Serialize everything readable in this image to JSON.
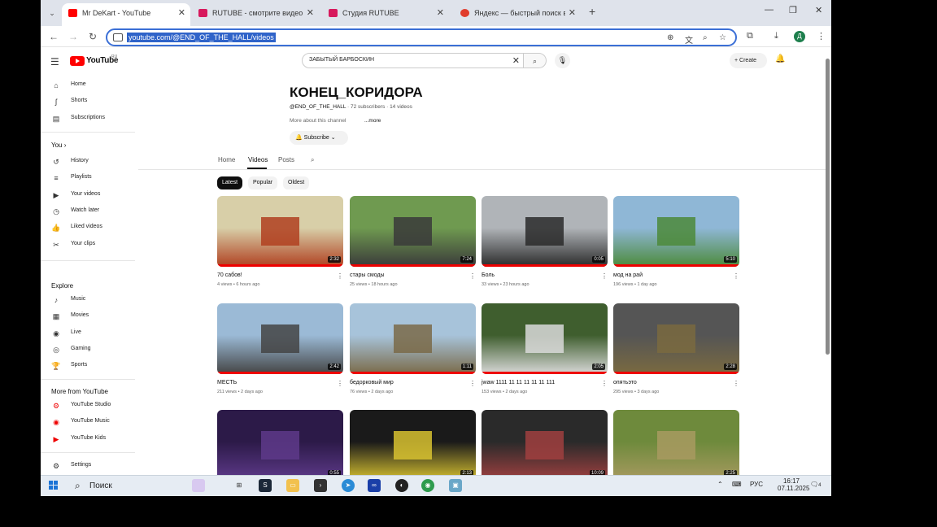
{
  "browser": {
    "tabs": [
      {
        "title": "Mr DeKart - YouTube",
        "favicon_color": "#ff0000"
      },
      {
        "title": "RUTUBE - смотрите видео онл...",
        "favicon_color": "#d7195d"
      },
      {
        "title": "Студия RUTUBE",
        "favicon_color": "#d7195d"
      },
      {
        "title": "Яндекс — быстрый поиск в ин...",
        "favicon_color": "#e03c2c"
      }
    ],
    "url": "youtube.com/@END_OF_THE_HALL/videos",
    "profile_initial": "Д"
  },
  "youtube": {
    "logo_text": "YouTube",
    "logo_region": "RU",
    "search_value": "ЗАБЫТЫЙ БАРБОСКИН",
    "create_label": "Create"
  },
  "sidebar": {
    "main": [
      {
        "label": "Home",
        "icon": "home-icon",
        "glyph": "⌂"
      },
      {
        "label": "Shorts",
        "icon": "shorts-icon",
        "glyph": "ʃ"
      },
      {
        "label": "Subscriptions",
        "icon": "subscriptions-icon",
        "glyph": "▤"
      }
    ],
    "you_title": "You",
    "you": [
      {
        "label": "History",
        "icon": "history-icon",
        "glyph": "↺"
      },
      {
        "label": "Playlists",
        "icon": "playlists-icon",
        "glyph": "≡"
      },
      {
        "label": "Your videos",
        "icon": "your-videos-icon",
        "glyph": "▶"
      },
      {
        "label": "Watch later",
        "icon": "watch-later-icon",
        "glyph": "◷"
      },
      {
        "label": "Liked videos",
        "icon": "liked-icon",
        "glyph": "👍"
      },
      {
        "label": "Your clips",
        "icon": "clips-icon",
        "glyph": "✂"
      }
    ],
    "explore_title": "Explore",
    "explore": [
      {
        "label": "Music",
        "icon": "music-icon",
        "glyph": "♪"
      },
      {
        "label": "Movies",
        "icon": "movies-icon",
        "glyph": "▦"
      },
      {
        "label": "Live",
        "icon": "live-icon",
        "glyph": "◉"
      },
      {
        "label": "Gaming",
        "icon": "gaming-icon",
        "glyph": "◎"
      },
      {
        "label": "Sports",
        "icon": "sports-icon",
        "glyph": "🏆"
      }
    ],
    "more_title": "More from YouTube",
    "more": [
      {
        "label": "YouTube Studio",
        "icon": "youtube-studio-icon",
        "glyph": "⚙"
      },
      {
        "label": "YouTube Music",
        "icon": "youtube-music-icon",
        "glyph": "◉"
      },
      {
        "label": "YouTube Kids",
        "icon": "youtube-kids-icon",
        "glyph": "▶"
      }
    ],
    "settings": {
      "label": "Settings",
      "icon": "settings-icon",
      "glyph": "⚙"
    }
  },
  "channel": {
    "name": "КОНЕЦ_КОРИДОРА",
    "handle": "@END_OF_THE_HALL",
    "subscribers": "72 subscribers",
    "videos_count": "14 videos",
    "about": "More about this channel",
    "more": "...more",
    "subscribe_label": "Subscribe",
    "tabs": [
      "Home",
      "Videos",
      "Posts"
    ],
    "active_tab": "Videos",
    "chips": [
      "Latest",
      "Popular",
      "Oldest"
    ],
    "active_chip": "Latest"
  },
  "videos": [
    {
      "title": "70 сабов!",
      "views": "4 views",
      "age": "6 hours ago",
      "duration": "2:32",
      "bg": "#d8cfa8",
      "accent": "#b04020"
    },
    {
      "title": "стары смоды",
      "views": "25 views",
      "age": "18 hours ago",
      "duration": "7:24",
      "bg": "#6f9a50",
      "accent": "#3a3a3a"
    },
    {
      "title": "Боль",
      "views": "33 views",
      "age": "23 hours ago",
      "duration": "0:05",
      "bg": "#b0b4b8",
      "accent": "#2a2a2a"
    },
    {
      "title": "мод на рай",
      "views": "196 views",
      "age": "1 day ago",
      "duration": "5:10",
      "bg": "#8fb7d6",
      "accent": "#4c8a3a"
    },
    {
      "title": "МЕСТЬ",
      "views": "211 views",
      "age": "2 days ago",
      "duration": "2:42",
      "bg": "#9bbad6",
      "accent": "#444444"
    },
    {
      "title": "бедорковый мир",
      "views": "76 views",
      "age": "2 days ago",
      "duration": "1:11",
      "bg": "#a7c3da",
      "accent": "#7a6a48"
    },
    {
      "title": "jwaw 1111 11 11 11 11 11 111",
      "views": "153 views",
      "age": "2 days ago",
      "duration": "2:05",
      "bg": "#3f5e2e",
      "accent": "#d9d9d9"
    },
    {
      "title": "опятьэто",
      "views": "295 views",
      "age": "3 days ago",
      "duration": "2:28",
      "bg": "#555555",
      "accent": "#7a6a40"
    },
    {
      "title": "",
      "views": "",
      "age": "",
      "duration": "0:55",
      "bg": "#2c1a48",
      "accent": "#5e3a8a"
    },
    {
      "title": "",
      "views": "",
      "age": "",
      "duration": "2:13",
      "bg": "#1a1a1a",
      "accent": "#d8c230"
    },
    {
      "title": "",
      "views": "",
      "age": "",
      "duration": "10:09",
      "bg": "#2a2a2a",
      "accent": "#a04040"
    },
    {
      "title": "",
      "views": "",
      "age": "",
      "duration": "2:25",
      "bg": "#6e8a3c",
      "accent": "#a89a60"
    }
  ],
  "taskbar": {
    "search_label": "Поиск",
    "lang": "РУС",
    "time": "16:17",
    "date": "07.11.2025",
    "notifications": "4"
  }
}
